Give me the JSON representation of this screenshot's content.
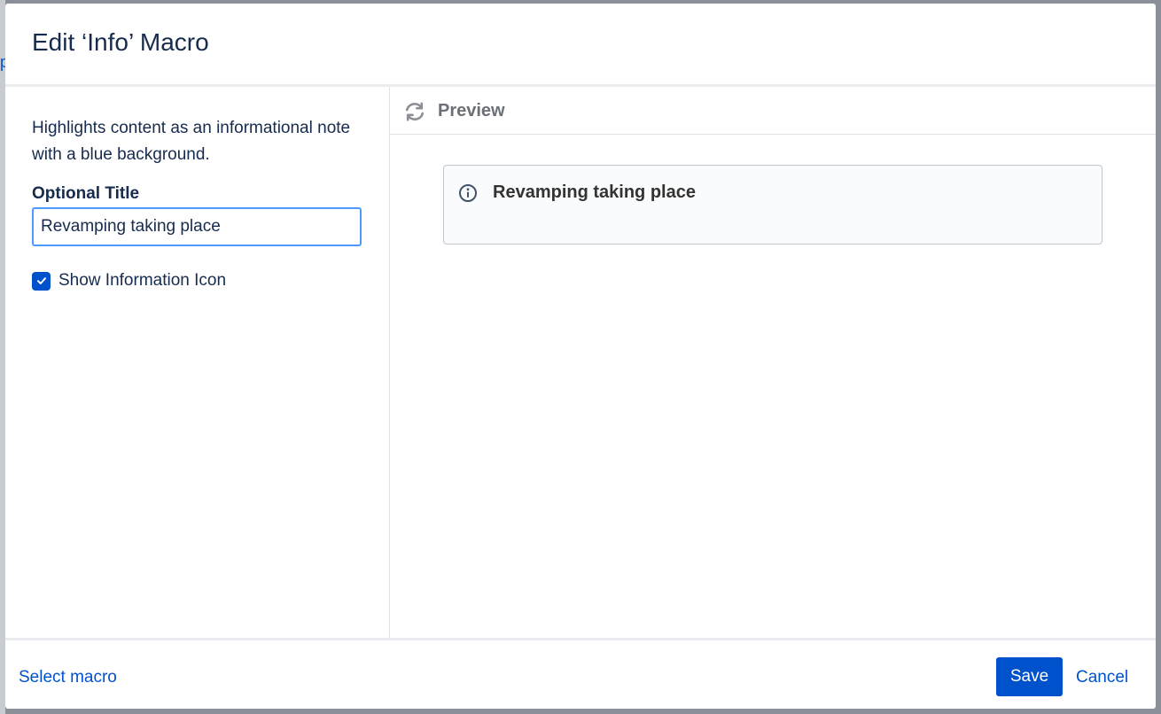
{
  "dialog": {
    "title": "Edit ‘Info’ Macro"
  },
  "form": {
    "description": "Highlights content as an informational note with a blue background.",
    "optional_title_label": "Optional Title",
    "optional_title_value": "Revamping taking place",
    "show_icon_label": "Show Information Icon",
    "show_icon_checked": true
  },
  "preview": {
    "label": "Preview",
    "refresh_icon": "refresh-icon",
    "panel_title": "Revamping taking place",
    "panel_icon": "info-icon"
  },
  "footer": {
    "select_macro_label": "Select macro",
    "save_label": "Save",
    "cancel_label": "Cancel"
  },
  "colors": {
    "accent": "#0052cc",
    "input_focus": "#4c9aff",
    "text": "#172b4d",
    "preview_panel_bg": "#fafbfc"
  }
}
